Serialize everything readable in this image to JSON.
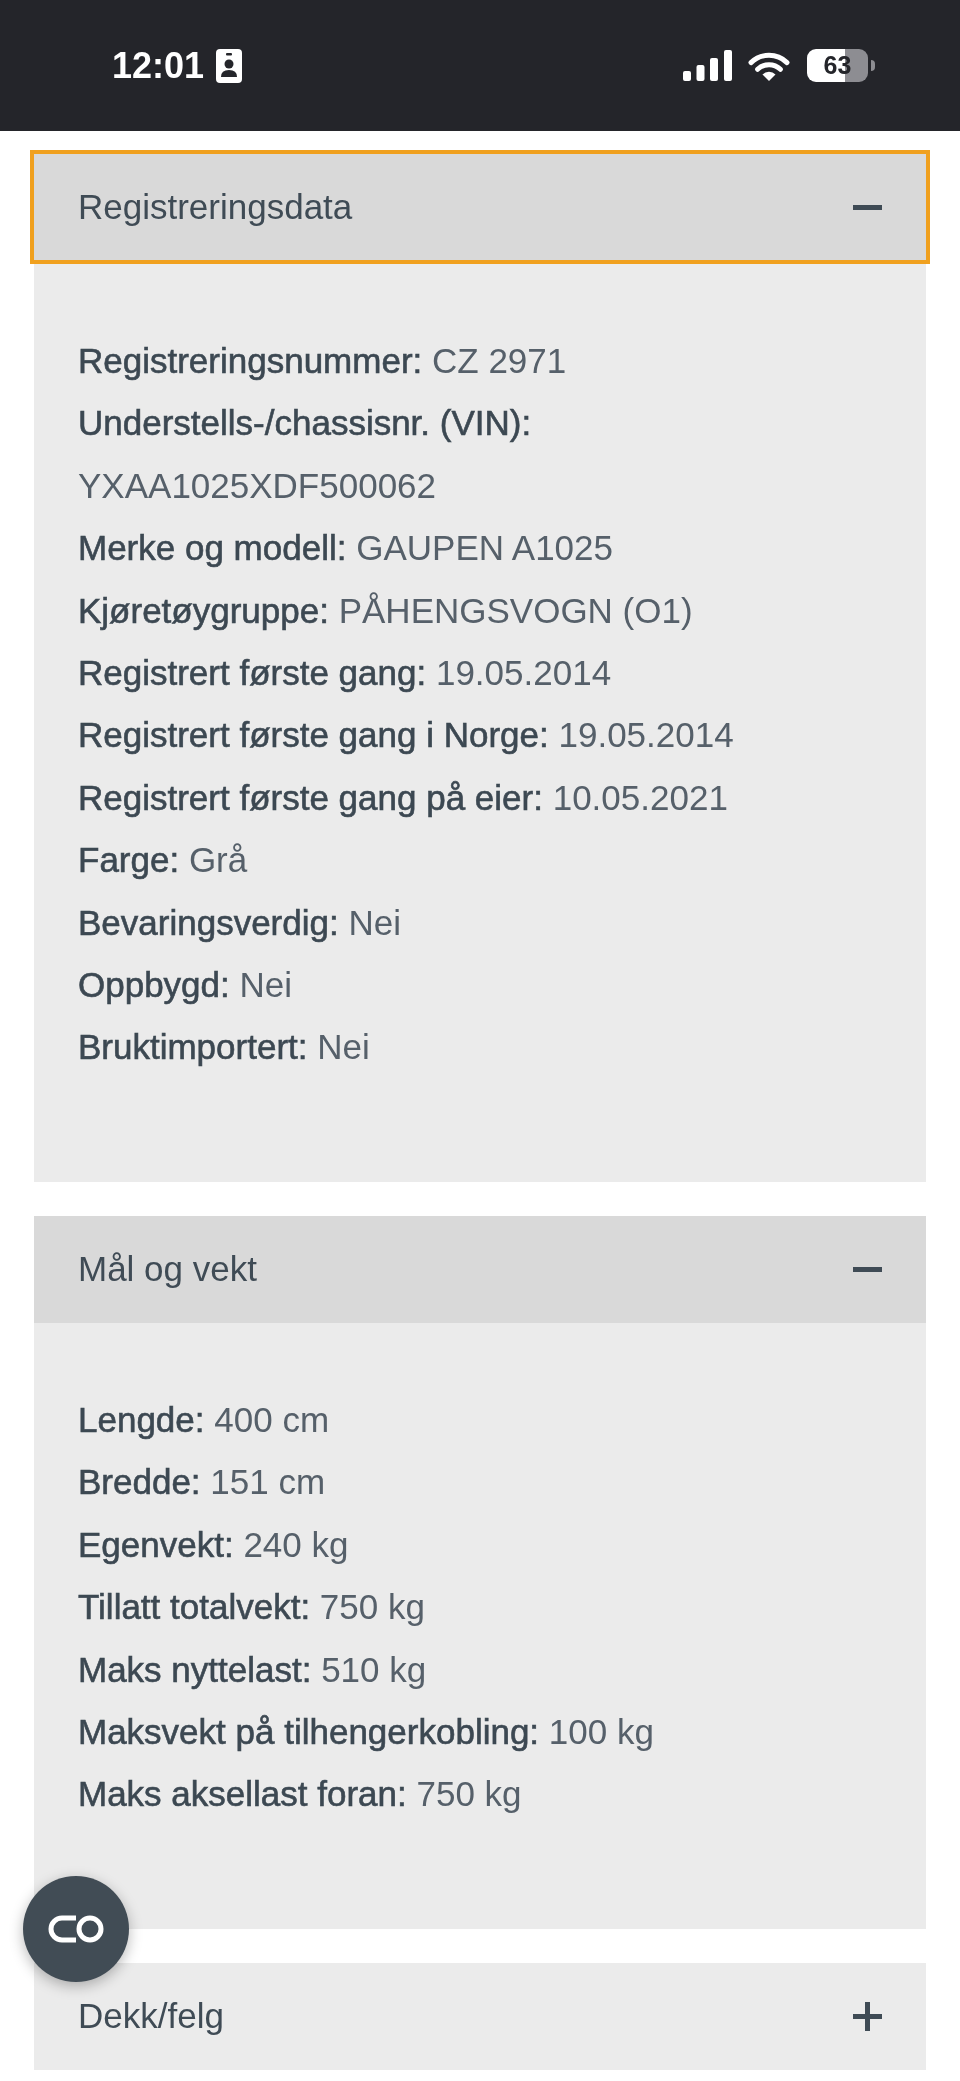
{
  "status_bar": {
    "time": "12:01",
    "battery": "63"
  },
  "sections": [
    {
      "title": "Registreringsdata",
      "expanded": true,
      "focused": true,
      "fields": [
        {
          "label": "Registreringsnummer:",
          "value": "CZ 2971"
        },
        {
          "label": "Understells-/chassisnr. (VIN):",
          "value": "YXAA1025XDF500062"
        },
        {
          "label": "Merke og modell:",
          "value": "GAUPEN A1025"
        },
        {
          "label": "Kjøretøygruppe:",
          "value": "PÅHENGSVOGN (O1)"
        },
        {
          "label": "Registrert første gang:",
          "value": "19.05.2014"
        },
        {
          "label": "Registrert første gang i Norge:",
          "value": "19.05.2014"
        },
        {
          "label": "Registrert første gang på eier:",
          "value": "10.05.2021"
        },
        {
          "label": "Farge:",
          "value": "Grå"
        },
        {
          "label": "Bevaringsverdig:",
          "value": "Nei"
        },
        {
          "label": "Oppbygd:",
          "value": "Nei"
        },
        {
          "label": "Bruktimportert:",
          "value": "Nei"
        }
      ]
    },
    {
      "title": "Mål og vekt",
      "expanded": true,
      "focused": false,
      "fields": [
        {
          "label": "Lengde:",
          "value": "400 cm"
        },
        {
          "label": "Bredde:",
          "value": "151 cm"
        },
        {
          "label": "Egenvekt:",
          "value": "240 kg"
        },
        {
          "label": "Tillatt totalvekt:",
          "value": "750 kg"
        },
        {
          "label": "Maks nyttelast:",
          "value": "510 kg"
        },
        {
          "label": "Maksvekt på tilhengerkobling:",
          "value": "100 kg"
        },
        {
          "label": "Maks aksellast foran:",
          "value": "750 kg"
        }
      ]
    },
    {
      "title": "Dekk/felg",
      "expanded": false,
      "focused": false
    }
  ]
}
